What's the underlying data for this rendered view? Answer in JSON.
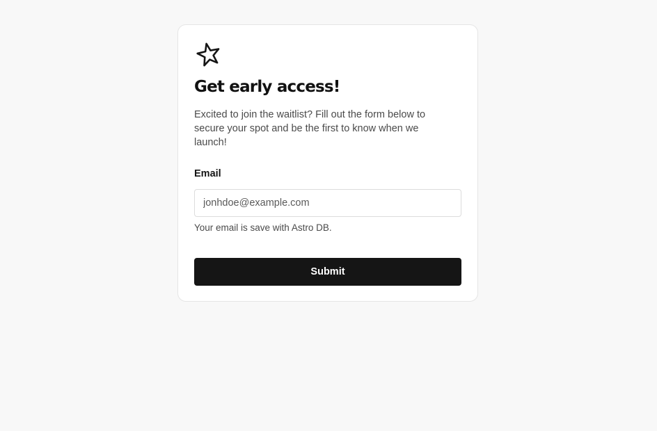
{
  "colors": {
    "page_background": "#f8f8f8",
    "card_background": "#ffffff",
    "primary": "#151515",
    "muted_text": "#4a4a4a"
  },
  "form": {
    "logo_icon": "star-icon",
    "title": "Get early access!",
    "description": "Excited to join the waitlist? Fill out the form below to secure your spot and be the first to know when we launch!",
    "email_label": "Email",
    "email_placeholder": "jonhdoe@example.com",
    "email_value": "",
    "email_hint": "Your email is save with Astro DB.",
    "submit_label": "Submit"
  }
}
